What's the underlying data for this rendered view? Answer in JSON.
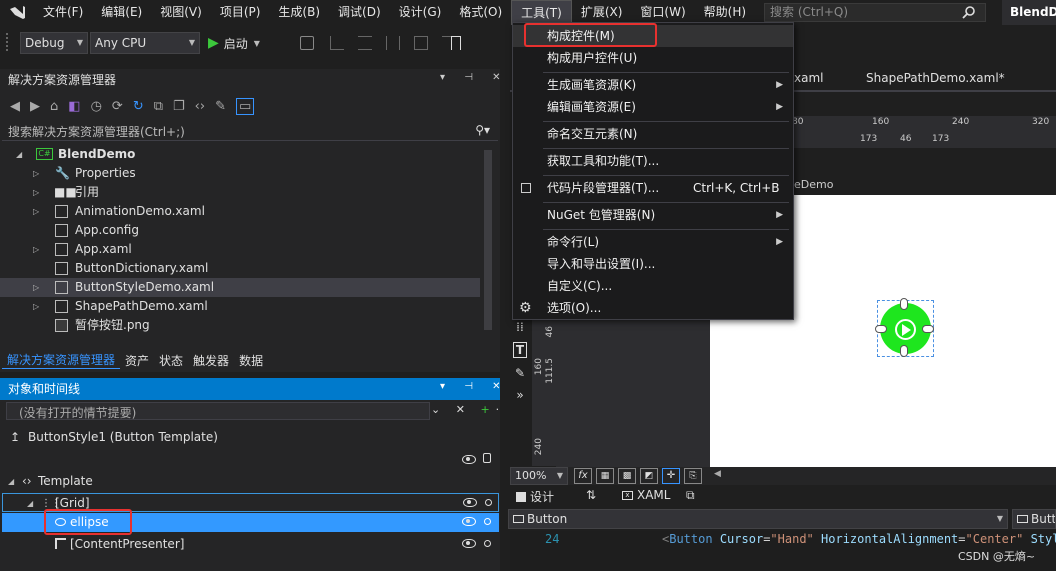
{
  "menubar": {
    "items": [
      "文件(F)",
      "编辑(E)",
      "视图(V)",
      "项目(P)",
      "生成(B)",
      "调试(D)",
      "设计(G)",
      "格式(O)",
      "工具(T)",
      "扩展(X)",
      "窗口(W)",
      "帮助(H)"
    ],
    "search_placeholder": "搜索 (Ctrl+Q)",
    "app_title": "BlendD"
  },
  "toolbar": {
    "config": "Debug",
    "platform": "Any CPU",
    "start_label": "启动"
  },
  "solution_explorer": {
    "title": "解决方案资源管理器",
    "search_placeholder": "搜索解决方案资源管理器(Ctrl+;)",
    "project": "BlendDemo",
    "items": [
      "Properties",
      "引用",
      "AnimationDemo.xaml",
      "App.config",
      "App.xaml",
      "ButtonDictionary.xaml",
      "ButtonStyleDemo.xaml",
      "ShapePathDemo.xaml",
      "暂停按钮.png"
    ],
    "tabs": [
      "解决方案资源管理器",
      "资产",
      "状态",
      "触发器",
      "数据"
    ]
  },
  "objects_timeline": {
    "title": "对象和时间线",
    "storyboard_placeholder": "(没有打开的情节提要)",
    "scope": "ButtonStyle1 (Button Template)",
    "template_label": "Template",
    "nodes": [
      "[Grid]",
      "ellipse",
      "[ContentPresenter]"
    ]
  },
  "tools_menu": {
    "items": [
      {
        "label": "构成控件(M)",
        "shortcut": "",
        "submenu": false
      },
      {
        "label": "构成用户控件(U)",
        "shortcut": "",
        "submenu": false
      },
      {
        "label": "生成画笔资源(K)",
        "shortcut": "",
        "submenu": true
      },
      {
        "label": "编辑画笔资源(E)",
        "shortcut": "",
        "submenu": true
      },
      {
        "label": "命名交互元素(N)",
        "shortcut": "",
        "submenu": false
      },
      {
        "label": "获取工具和功能(T)...",
        "shortcut": "",
        "submenu": false
      },
      {
        "label": "代码片段管理器(T)...",
        "shortcut": "Ctrl+K, Ctrl+B",
        "submenu": false
      },
      {
        "label": "NuGet 包管理器(N)",
        "shortcut": "",
        "submenu": true
      },
      {
        "label": "命令行(L)",
        "shortcut": "",
        "submenu": true
      },
      {
        "label": "导入和导出设置(I)...",
        "shortcut": "",
        "submenu": false
      },
      {
        "label": "自定义(C)...",
        "shortcut": "",
        "submenu": false
      },
      {
        "label": "选项(O)...",
        "shortcut": "",
        "submenu": false
      }
    ]
  },
  "editor": {
    "tabs": [
      "xaml",
      "ShapePathDemo.xaml*"
    ],
    "ruler_top": [
      "80",
      "160",
      "240",
      "320"
    ],
    "ruler_sub": [
      "173",
      "46",
      "173"
    ],
    "doc_label": "eDemo",
    "ruler_left": [
      "46",
      "160",
      "111.5",
      "240"
    ],
    "zoom": "100%",
    "design_tab": "设计",
    "xaml_tab": "XAML",
    "element_combo": "Button",
    "element_combo_right": "Butt",
    "line_number": "24",
    "code_tag": "Button",
    "code_attr1": "Cursor",
    "code_val1": "\"Hand\"",
    "code_attr2": "HorizontalAlignment",
    "code_val2": "\"Center\"",
    "code_attr3": "Styl"
  },
  "watermark": "CSDN @无熵~",
  "colors": {
    "accent": "#007acc",
    "highlight": "#e8312f",
    "green": "#1ee61e"
  }
}
